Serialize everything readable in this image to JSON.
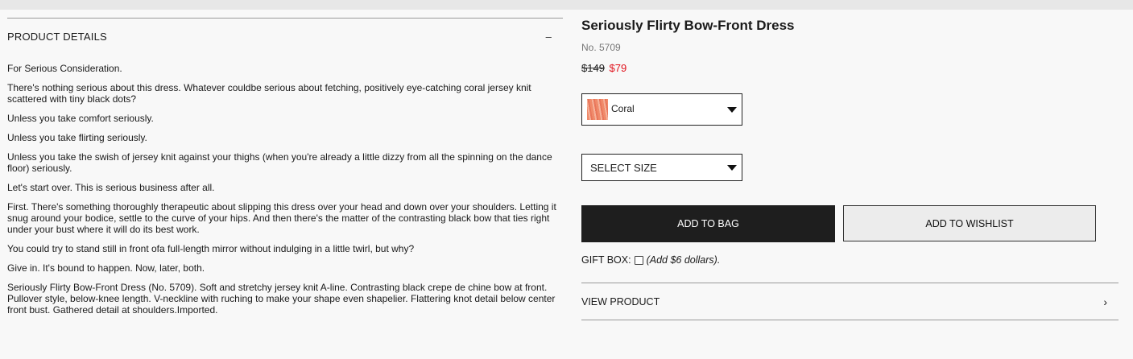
{
  "details": {
    "heading": "PRODUCT DETAILS",
    "toggle_icon": "–",
    "paragraphs": [
      "For Serious Consideration.",
      "There's nothing serious about this dress. Whatever couldbe serious about fetching, positively eye-catching coral jersey knit scattered with tiny black dots?",
      "Unless you take comfort seriously.",
      "Unless you take flirting seriously.",
      "Unless you take the swish of jersey knit against your thighs (when you're already a little dizzy from all the spinning on the dance floor) seriously.",
      "Let's start over. This is serious business after all.",
      "First. There's something thoroughly therapeutic about slipping this dress over your head and down over your shoulders. Letting it snug around your bodice, settle to the curve of your hips. And then there's the matter of the contrasting black bow that ties right under your bust where it will do its best work.",
      "You could try to stand still in front ofa full-length mirror without indulging in a little twirl, but why?",
      "Give in. It's bound to happen. Now, later, both.",
      "Seriously Flirty Bow-Front Dress (No. 5709). Soft and stretchy jersey knit A-line. Contrasting black crepe de chine bow at front. Pullover style, below-knee length. V-neckline with ruching to make your shape even shapelier. Flattering knot detail below center front bust. Gathered detail at shoulders.Imported."
    ]
  },
  "product": {
    "title": "Seriously Flirty Bow-Front Dress",
    "sku": "No. 5709",
    "price_old": "$149",
    "price_new": "$79",
    "sale_color": "#e0101a",
    "color_select": {
      "value": "Coral",
      "swatch_color": "#f08a6a"
    },
    "size_select": {
      "value": "SELECT SIZE"
    },
    "add_to_bag": "ADD TO BAG",
    "add_to_wishlist": "ADD TO WISHLIST",
    "gift_label": "GIFT BOX:",
    "gift_note": "(Add $6 dollars).",
    "view_product": "VIEW PRODUCT",
    "view_product_icon": "›"
  }
}
